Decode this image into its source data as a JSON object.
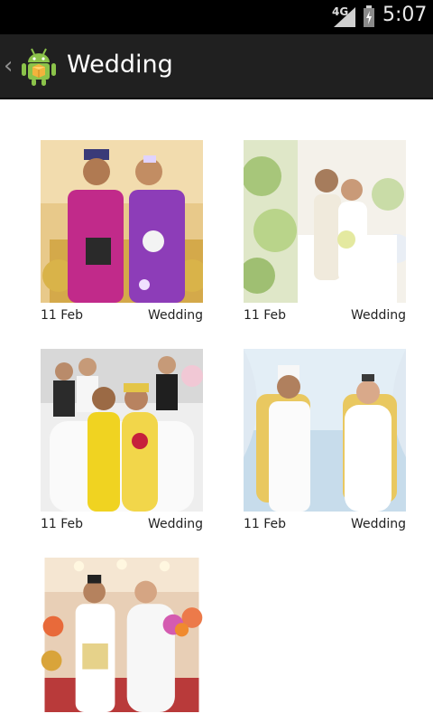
{
  "status_bar": {
    "network": "4G",
    "time": "5:07"
  },
  "action_bar": {
    "title": "Wedding"
  },
  "items": [
    {
      "date": "11 Feb",
      "category": "Wedding"
    },
    {
      "date": "11 Feb",
      "category": "Wedding"
    },
    {
      "date": "11 Feb",
      "category": "Wedding"
    },
    {
      "date": "11 Feb",
      "category": "Wedding"
    },
    {
      "date": "",
      "category": ""
    }
  ]
}
